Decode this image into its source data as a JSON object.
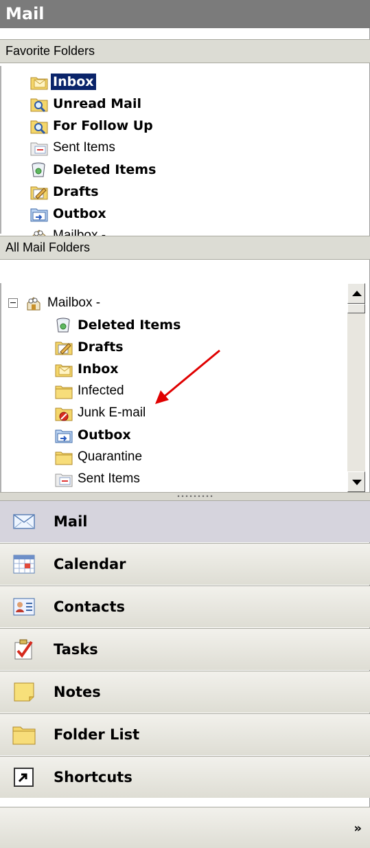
{
  "header": {
    "title": "Mail"
  },
  "favorites": {
    "title": "Favorite Folders",
    "items": [
      {
        "label": "Inbox",
        "icon": "inbox-folder-icon"
      },
      {
        "label": "Unread Mail",
        "icon": "search-folder-icon"
      },
      {
        "label": "For Follow Up",
        "icon": "search-folder-icon"
      },
      {
        "label": "Sent Items",
        "icon": "sent-items-icon"
      },
      {
        "label": "Deleted Items",
        "icon": "trash-can-icon"
      },
      {
        "label": "Drafts",
        "icon": "drafts-icon"
      },
      {
        "label": "Outbox",
        "icon": "outbox-icon"
      },
      {
        "label": "Mailbox -",
        "icon": "mailbox-icon"
      }
    ]
  },
  "all_folders": {
    "title": "All Mail Folders",
    "root": {
      "label": "Mailbox -",
      "icon": "mailbox-icon"
    },
    "items": [
      {
        "label": "Deleted Items",
        "icon": "trash-can-icon"
      },
      {
        "label": "Drafts",
        "icon": "drafts-icon"
      },
      {
        "label": "Inbox",
        "icon": "inbox-folder-icon"
      },
      {
        "label": "Infected",
        "icon": "folder-icon"
      },
      {
        "label": "Junk E-mail",
        "icon": "junk-folder-icon"
      },
      {
        "label": "Outbox",
        "icon": "outbox-icon"
      },
      {
        "label": "Quarantine",
        "icon": "folder-icon"
      },
      {
        "label": "Sent Items",
        "icon": "sent-items-icon"
      }
    ]
  },
  "nav": {
    "buttons": [
      {
        "label": "Mail",
        "icon": "envelope-icon"
      },
      {
        "label": "Calendar",
        "icon": "calendar-icon"
      },
      {
        "label": "Contacts",
        "icon": "contact-card-icon"
      },
      {
        "label": "Tasks",
        "icon": "checkmark-clipboard-icon"
      },
      {
        "label": "Notes",
        "icon": "sticky-note-icon"
      },
      {
        "label": "Folder List",
        "icon": "folder-icon"
      },
      {
        "label": "Shortcuts",
        "icon": "shortcut-arrow-icon"
      }
    ],
    "more_glyph": "»"
  },
  "colors": {
    "header_bg": "#7b7b7b",
    "selected_bg": "#0a246a",
    "annotation_arrow": "#e00000",
    "folder_yellow": "#f4d66a"
  }
}
